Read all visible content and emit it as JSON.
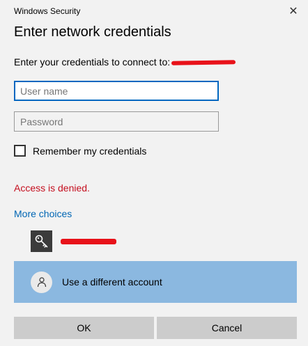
{
  "window": {
    "title": "Windows Security",
    "close_glyph": "✕"
  },
  "dialog": {
    "heading": "Enter network credentials",
    "prompt": "Enter your credentials to connect to:",
    "username": {
      "placeholder": "User name",
      "value": ""
    },
    "password": {
      "placeholder": "Password",
      "value": ""
    },
    "remember_label": "Remember my credentials",
    "remember_checked": false,
    "error": "Access is denied.",
    "more_choices": "More choices",
    "saved_credential_icon": "key-icon",
    "other_account_label": "Use a different account",
    "other_account_icon": "person-icon",
    "ok_label": "OK",
    "cancel_label": "Cancel"
  },
  "colors": {
    "background": "#f2f2f2",
    "focus_border": "#0067c0",
    "error": "#c50f1f",
    "link": "#0066b4",
    "selected_option": "#8bb8e0",
    "button": "#cccccc",
    "redaction": "#e8121a"
  }
}
